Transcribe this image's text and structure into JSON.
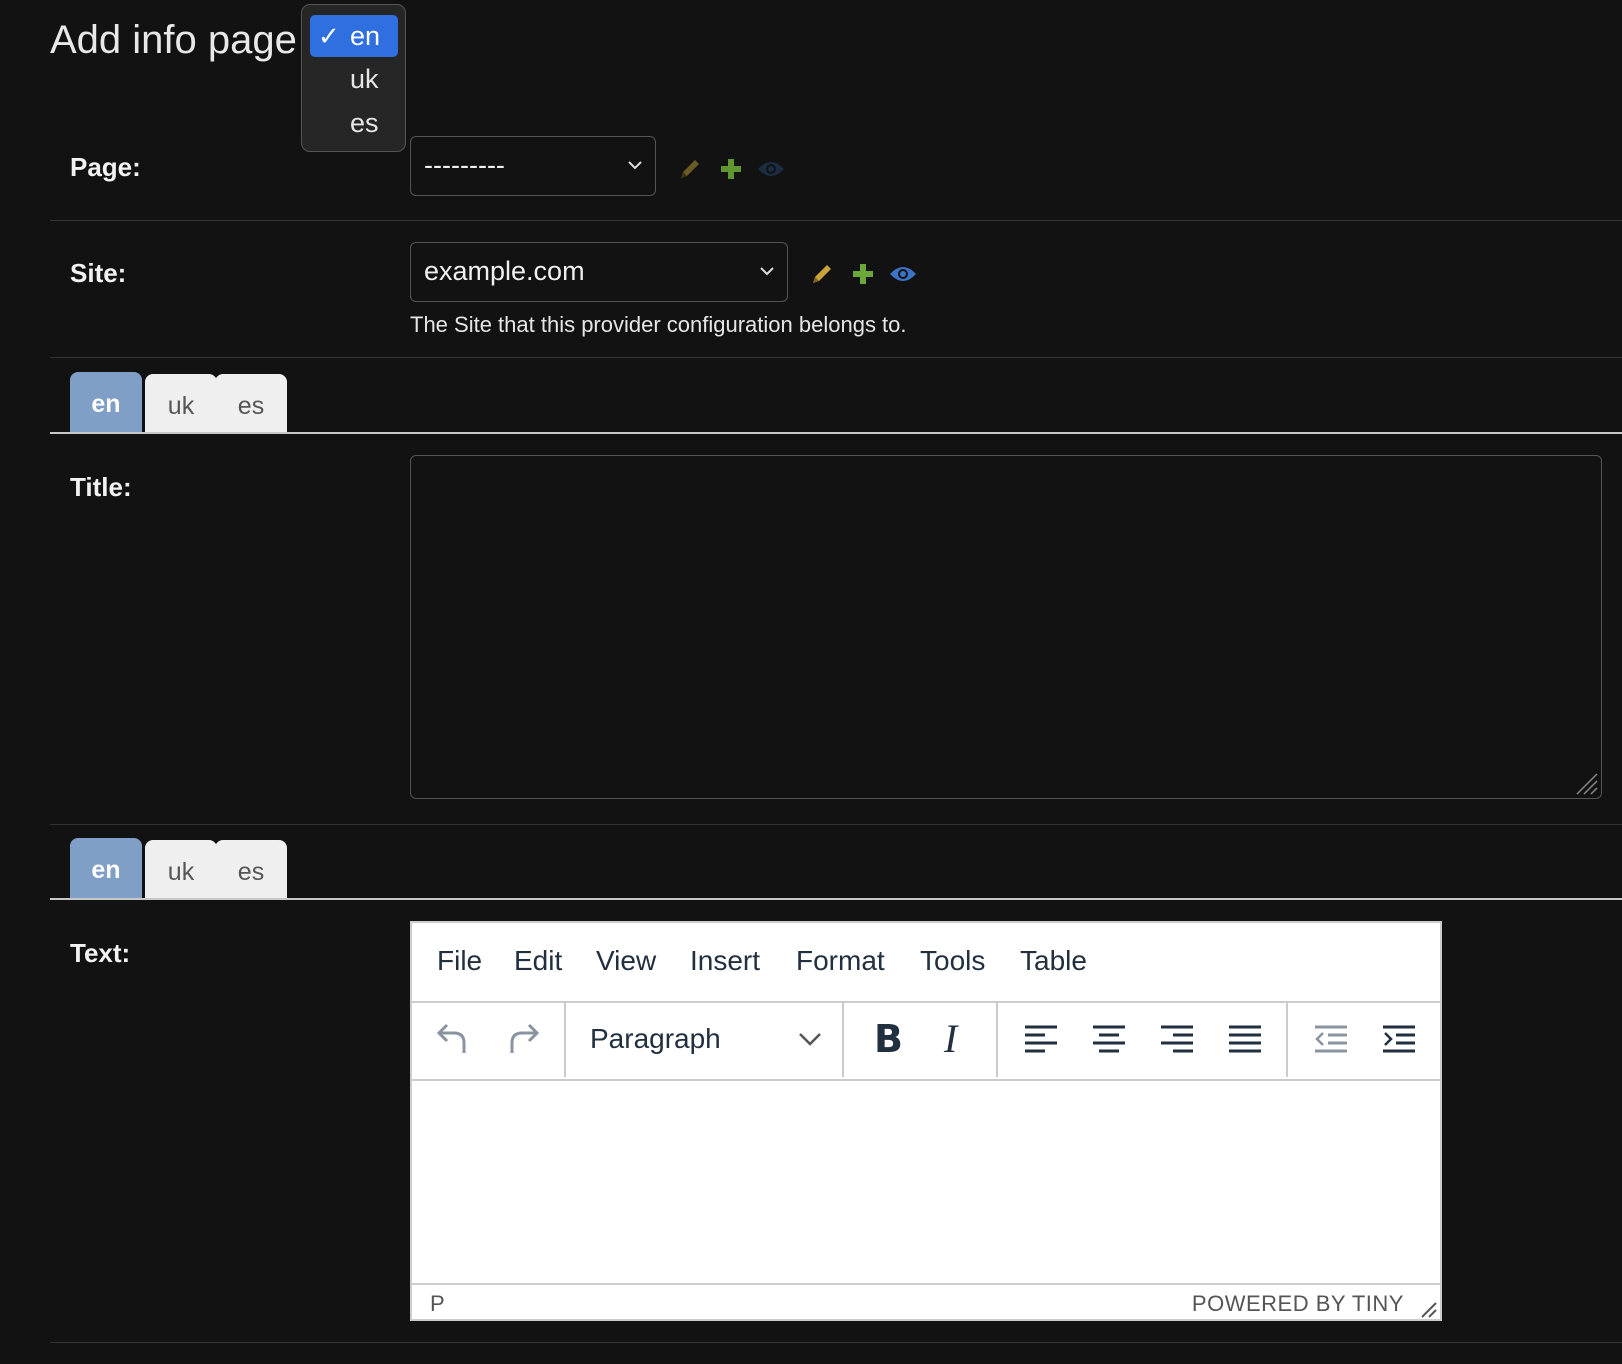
{
  "page": {
    "title": "Add info page",
    "language_menu": {
      "options": [
        "en",
        "uk",
        "es"
      ],
      "selected": "en"
    }
  },
  "fields": {
    "page": {
      "label": "Page:",
      "value": "---------"
    },
    "site": {
      "label": "Site:",
      "value": "example.com",
      "help": "The Site that this provider configuration belongs to."
    },
    "title": {
      "label": "Title:",
      "tabs": [
        "en",
        "uk",
        "es"
      ],
      "active_tab": "en",
      "value": ""
    },
    "text": {
      "label": "Text:",
      "tabs": [
        "en",
        "uk",
        "es"
      ],
      "active_tab": "en",
      "editor": {
        "menu": [
          "File",
          "Edit",
          "View",
          "Insert",
          "Format",
          "Tools",
          "Table"
        ],
        "block_format": "Paragraph",
        "status_path": "P",
        "branding": "POWERED BY TINY"
      }
    }
  },
  "icons": {
    "edit": "pencil-icon",
    "add": "plus-icon",
    "view": "eye-icon",
    "colors": {
      "pencil": "#c9a23a",
      "plus": "#6aa83a",
      "eye": "#3b73c7"
    }
  }
}
